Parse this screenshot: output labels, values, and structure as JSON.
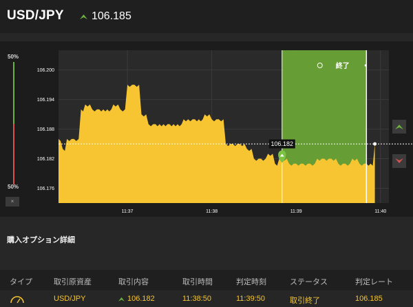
{
  "header": {
    "pair": "USD/JPY",
    "rate": "106.185",
    "direction_icon": "up-arrow-icon",
    "up_color": "#6db33f"
  },
  "gauge": {
    "top_label": "50%",
    "bottom_label": "50%",
    "close_label": "×",
    "up_color": "#6db33f",
    "down_color": "#d9534f"
  },
  "chart_data": {
    "type": "area",
    "title": "",
    "xlabel": "",
    "ylabel": "",
    "y_ticks": [
      "106.200",
      "106.194",
      "106.188",
      "106.182",
      "106.176"
    ],
    "x_ticks": [
      "11:37",
      "11:38",
      "11:39",
      "11:40"
    ],
    "ylim": [
      106.173,
      106.204
    ],
    "xlim": [
      "11:36:11",
      "11:40:06"
    ],
    "series": [
      {
        "x": [
          "11:36:11",
          "11:36:14",
          "11:36:17",
          "11:36:22",
          "11:36:27",
          "11:36:30",
          "11:36:35",
          "11:36:40",
          "11:36:50",
          "11:36:55",
          "11:37:00",
          "11:37:05",
          "11:37:10",
          "11:37:15",
          "11:37:20",
          "11:37:30",
          "11:37:40",
          "11:37:48",
          "11:37:55",
          "11:38:00",
          "11:38:05",
          "11:38:10",
          "11:38:15",
          "11:38:20",
          "11:38:25",
          "11:38:30",
          "11:38:35",
          "11:38:40",
          "11:38:45",
          "11:38:48",
          "11:38:50",
          "11:38:55",
          "11:39:00",
          "11:39:05",
          "11:39:10",
          "11:39:15",
          "11:39:20",
          "11:39:25",
          "11:39:30",
          "11:39:35",
          "11:39:40",
          "11:39:45",
          "11:39:50",
          "11:39:56"
        ],
        "y": [
          106.186,
          106.184,
          106.186,
          106.186,
          106.192,
          106.193,
          106.192,
          106.192,
          106.193,
          106.192,
          106.197,
          106.197,
          106.191,
          106.189,
          106.189,
          106.189,
          106.19,
          106.19,
          106.191,
          106.19,
          106.19,
          106.185,
          106.185,
          106.185,
          106.184,
          106.182,
          106.182,
          106.183,
          106.181,
          106.182,
          106.182,
          106.181,
          106.181,
          106.181,
          106.181,
          106.182,
          106.182,
          106.182,
          106.181,
          106.181,
          106.182,
          106.181,
          106.181,
          106.185
        ]
      }
    ],
    "area_color": "#f7c531",
    "grid": true,
    "current_line": {
      "value": 106.185
    },
    "entry": {
      "time": "11:38:50",
      "value": 106.182,
      "label": "106.182"
    },
    "expiry_zone": {
      "start": "11:38:50",
      "end": "11:39:50",
      "color": "#6aa336",
      "label": "終了"
    },
    "judge_line": {
      "time": "11:39:50"
    }
  },
  "trade_buttons": {
    "up_icon": "chevron-up-icon",
    "down_icon": "chevron-down-icon"
  },
  "details": {
    "title": "購入オプション詳細",
    "columns": [
      "タイプ",
      "取引原資産",
      "取引内容",
      "取引時間",
      "判定時刻",
      "ステータス",
      "判定レート"
    ],
    "row": {
      "type_icon": "clock-gauge-icon",
      "asset": "USD/JPY",
      "content": "106.182",
      "trade_time": "11:38:50",
      "judge_time": "11:39:50",
      "status": "取引終了",
      "rate": "106.185"
    }
  }
}
